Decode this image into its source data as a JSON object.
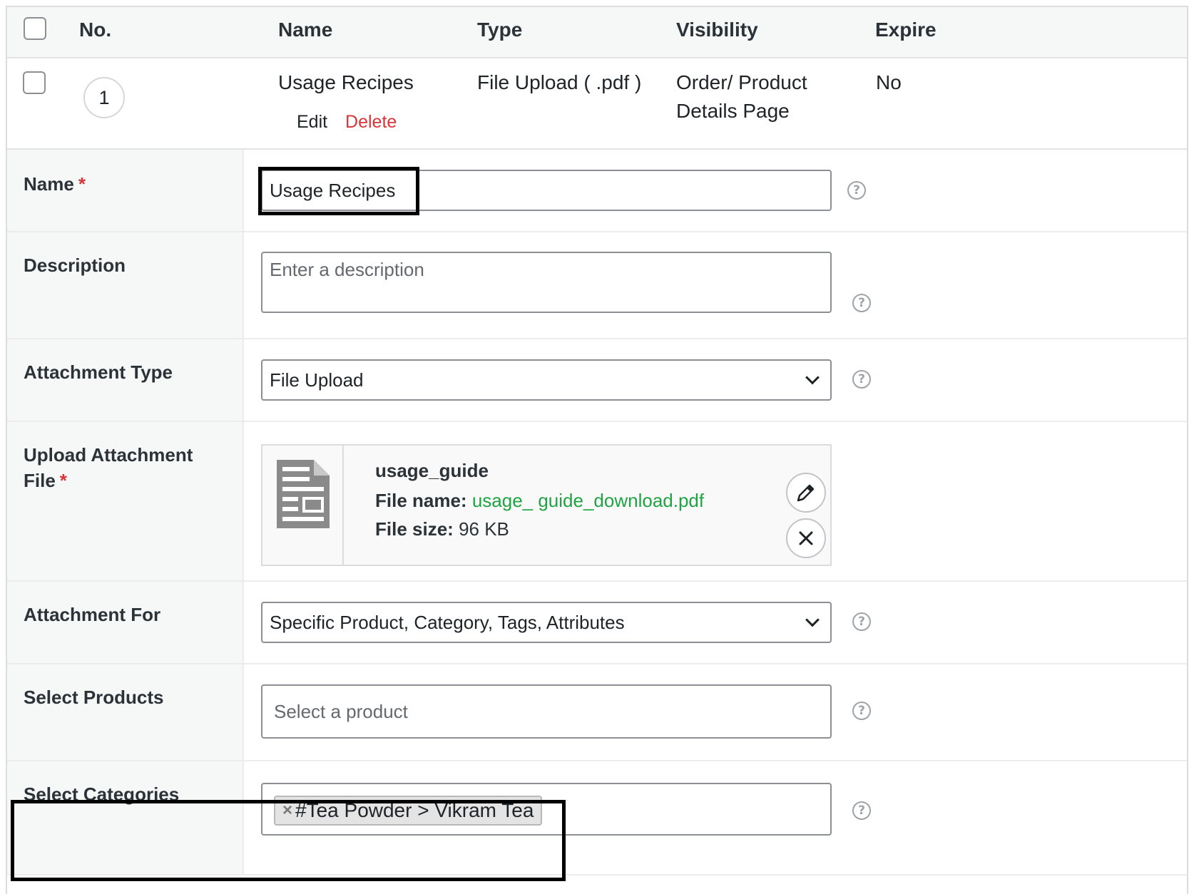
{
  "table": {
    "headers": {
      "no": "No.",
      "name": "Name",
      "type": "Type",
      "visibility": "Visibility",
      "expire": "Expire"
    },
    "row": {
      "number": "1",
      "name": "Usage Recipes",
      "type": "File Upload ( .pdf )",
      "visibility_line1": "Order/ Product",
      "visibility_line2": "Details Page",
      "expire": "No",
      "edit": "Edit",
      "delete": "Delete"
    }
  },
  "form": {
    "name": {
      "label": "Name",
      "required": "*",
      "value": "Usage Recipes"
    },
    "description": {
      "label": "Description",
      "placeholder": "Enter a description"
    },
    "attachment_type": {
      "label": "Attachment Type",
      "value": "File Upload"
    },
    "upload": {
      "label_line1": "Upload Attachment",
      "label_line2": "File",
      "required": "*",
      "title": "usage_guide",
      "file_name_label": "File name:",
      "file_name": "usage_ guide_download.pdf",
      "file_size_label": "File size:",
      "file_size": "96 KB"
    },
    "attachment_for": {
      "label": "Attachment For",
      "value": "Specific Product, Category, Tags, Attributes"
    },
    "select_products": {
      "label": "Select Products",
      "placeholder": "Select a product"
    },
    "select_categories": {
      "label": "Select Categories",
      "chip_remove": "×",
      "chip": "#Tea Powder > Vikram Tea"
    },
    "help_glyph": "?"
  },
  "colors": {
    "accent_link": "#1ea442",
    "delete": "#d63638",
    "required": "#d63638"
  }
}
